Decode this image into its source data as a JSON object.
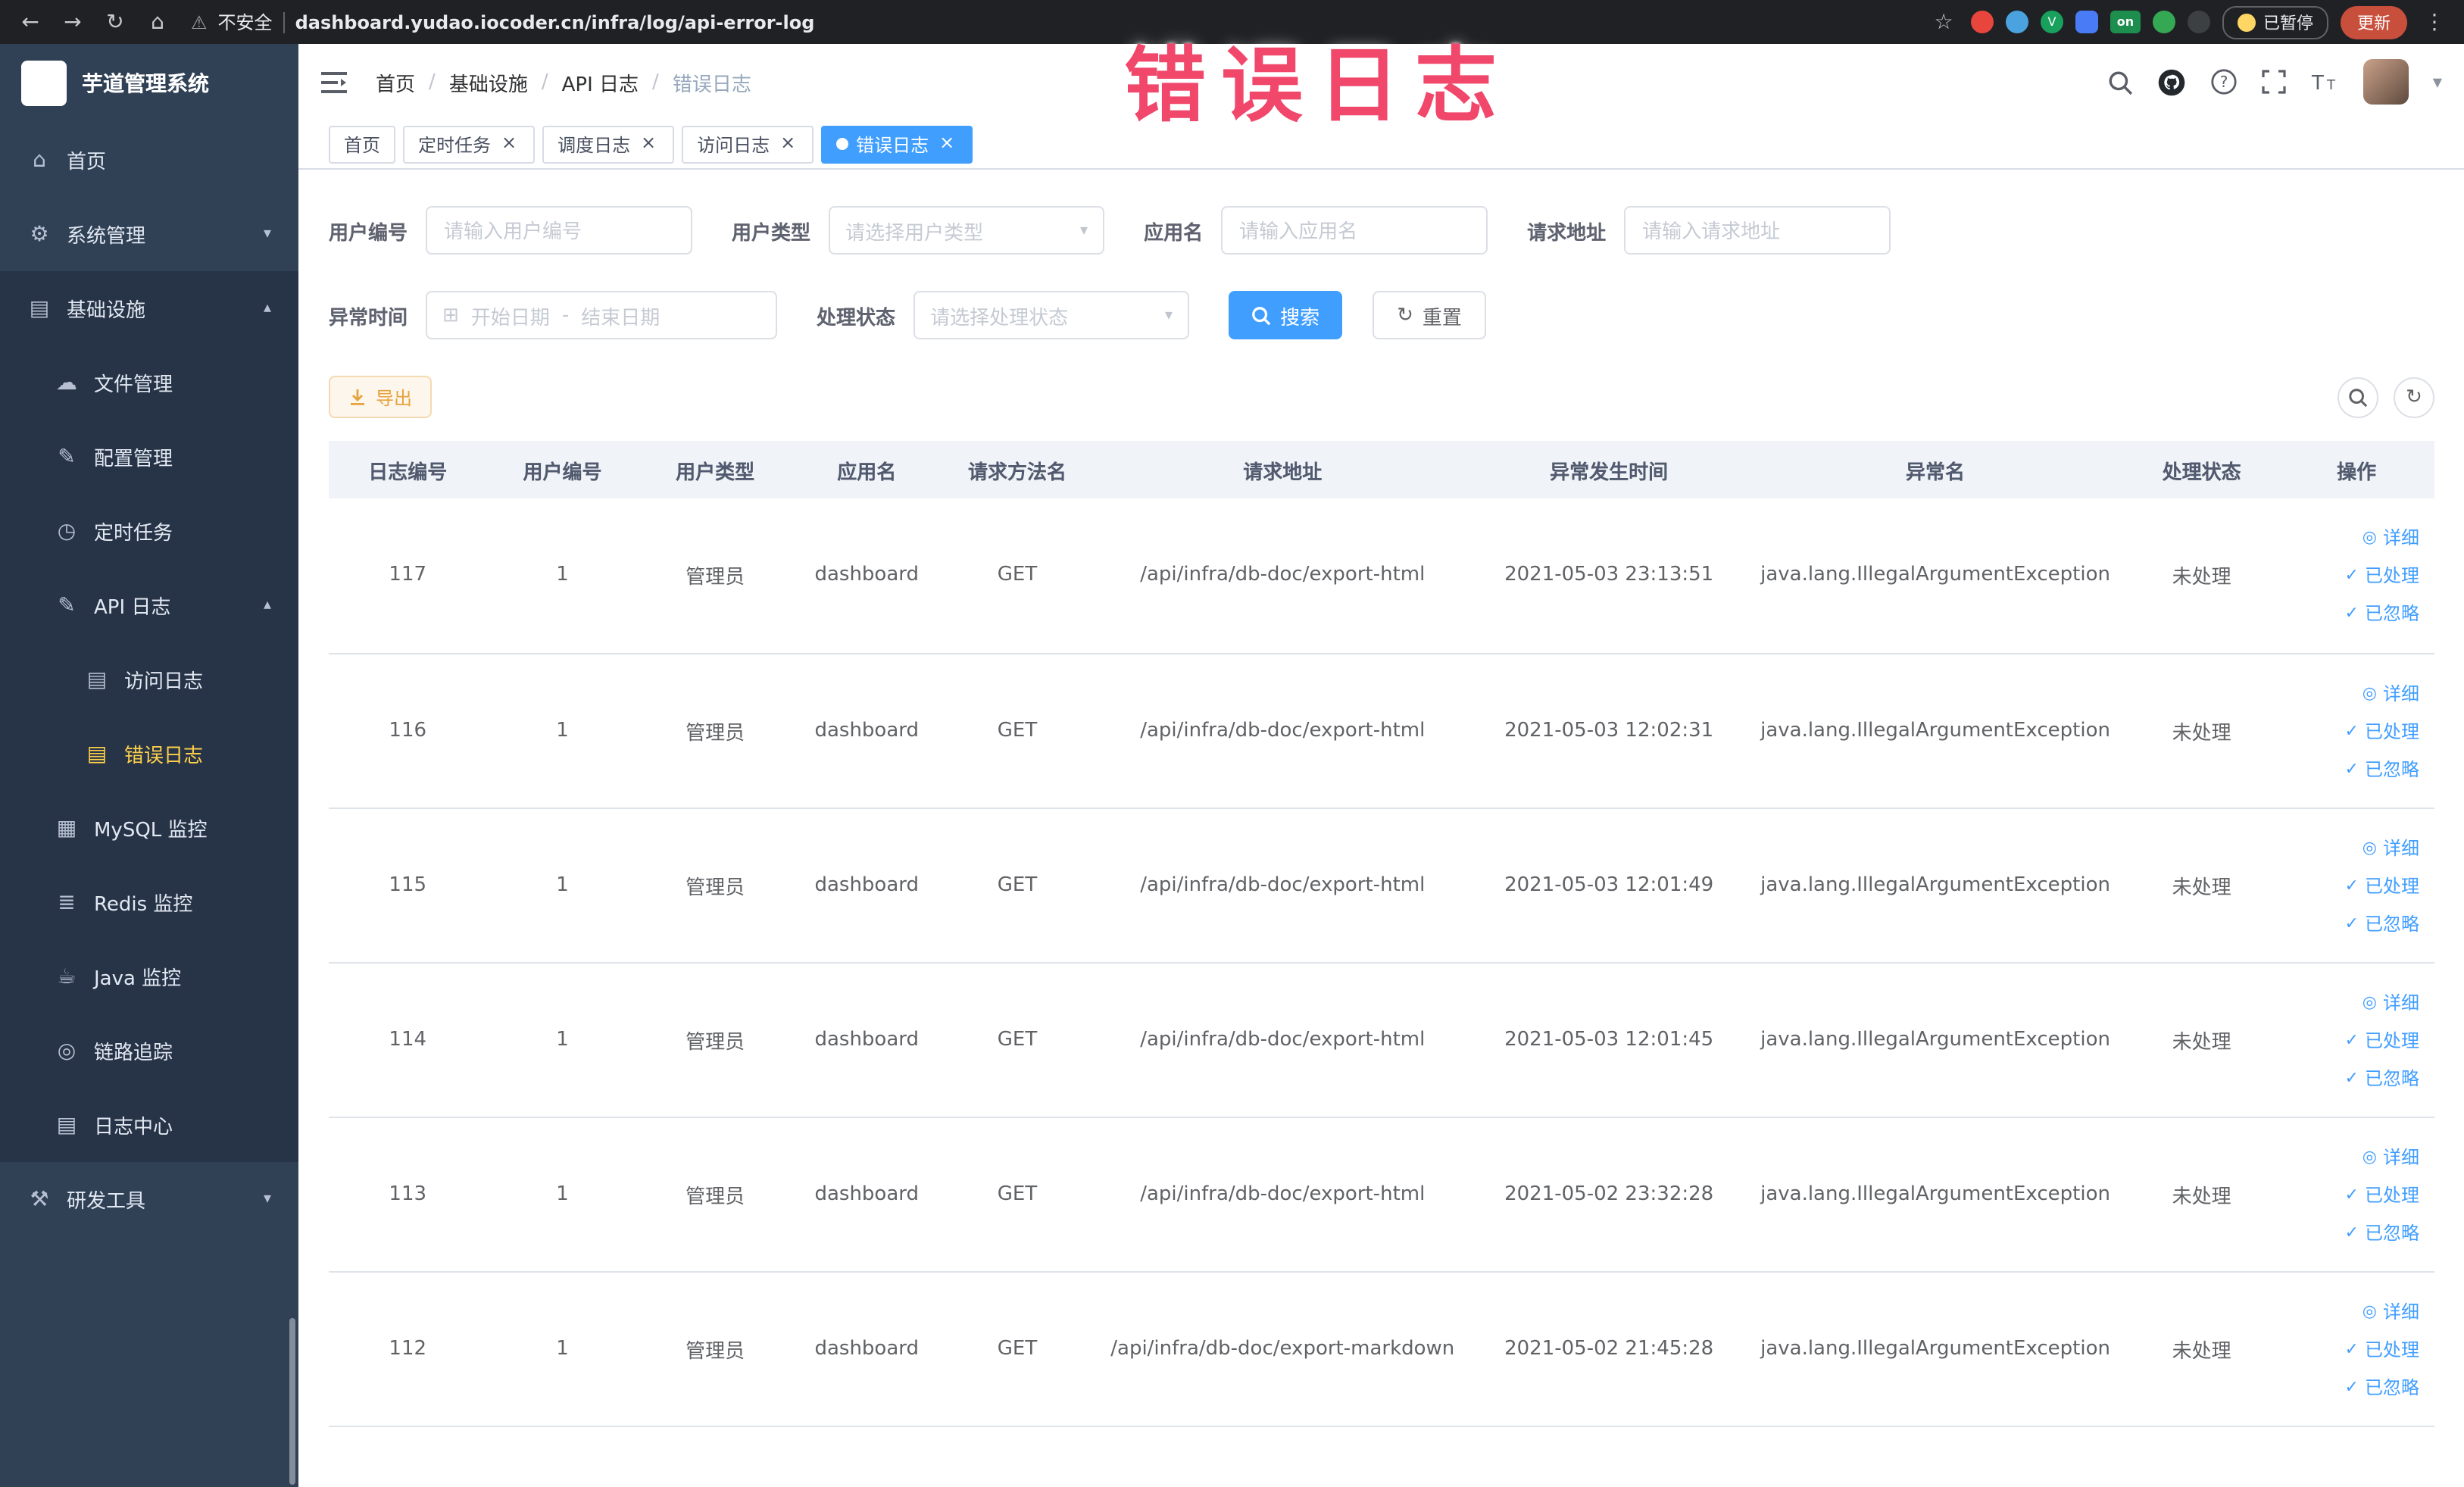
{
  "annotation": {
    "text": "错误日志"
  },
  "colors": {
    "primary": "#409eff",
    "warning_text": "#e6a23c",
    "sidebar_bg": "#304156",
    "sidebar_submenu_bg": "#273447",
    "active_menu_text": "#ffd04b",
    "annotation_pink": "#f0476b",
    "link_blue": "#409eff"
  },
  "browser": {
    "security_label": "不安全",
    "url": "dashboard.yudao.iocoder.cn/infra/log/api-error-log",
    "ext_v_label": "V",
    "on_badge": "on",
    "paused_badge": "已暂停",
    "update_button": "更新"
  },
  "icons": {
    "back": "←",
    "forward": "→",
    "reload": "↻",
    "home": "⌂",
    "warning": "⚠",
    "star": "☆",
    "menu_dots": "⋮",
    "close": "×",
    "chevron_down": "▾",
    "chevron_up": "▴",
    "dropdown": "▾",
    "calendar": "⊞",
    "check": "✓",
    "eye": "◎",
    "refresh": "↻",
    "caret": "▼",
    "separator": "/",
    "range_dash": "-"
  },
  "sidebar": {
    "logo_title": "芋道管理系统",
    "items": [
      {
        "label": "首页",
        "icon": "⌂"
      },
      {
        "label": "系统管理",
        "icon": "⚙"
      },
      {
        "label": "基础设施",
        "icon": "▤"
      },
      {
        "label": "文件管理",
        "icon": "☁"
      },
      {
        "label": "配置管理",
        "icon": "✎"
      },
      {
        "label": "定时任务",
        "icon": "◷"
      },
      {
        "label": "API 日志",
        "icon": "✎"
      },
      {
        "label": "访问日志",
        "icon": "▤"
      },
      {
        "label": "错误日志",
        "icon": "▤"
      },
      {
        "label": "MySQL 监控",
        "icon": "▦"
      },
      {
        "label": "Redis 监控",
        "icon": "≣"
      },
      {
        "label": "Java 监控",
        "icon": "☕"
      },
      {
        "label": "链路追踪",
        "icon": "◎"
      },
      {
        "label": "日志中心",
        "icon": "▤"
      },
      {
        "label": "研发工具",
        "icon": "⚒"
      }
    ]
  },
  "breadcrumb": [
    "首页",
    "基础设施",
    "API 日志",
    "错误日志"
  ],
  "tabs": [
    {
      "label": "首页"
    },
    {
      "label": "定时任务"
    },
    {
      "label": "调度日志"
    },
    {
      "label": "访问日志"
    },
    {
      "label": "错误日志"
    }
  ],
  "filters": {
    "user_id_label": "用户编号",
    "user_id_placeholder": "请输入用户编号",
    "user_type_label": "用户类型",
    "user_type_placeholder": "请选择用户类型",
    "app_name_label": "应用名",
    "app_name_placeholder": "请输入应用名",
    "request_url_label": "请求地址",
    "request_url_placeholder": "请输入请求地址",
    "exception_time_label": "异常时间",
    "start_date_placeholder": "开始日期",
    "end_date_placeholder": "结束日期",
    "process_status_label": "处理状态",
    "process_status_placeholder": "请选择处理状态",
    "search_button": "搜索",
    "reset_button": "重置"
  },
  "toolbar": {
    "export_button": "导出"
  },
  "table": {
    "columns": [
      "日志编号",
      "用户编号",
      "用户类型",
      "应用名",
      "请求方法名",
      "请求地址",
      "异常发生时间",
      "异常名",
      "处理状态",
      "操作"
    ],
    "actions": [
      "详细",
      "已处理",
      "已忽略"
    ],
    "rows": [
      {
        "id": "117",
        "user_id": "1",
        "user_type": "管理员",
        "app": "dashboard",
        "method": "GET",
        "url": "/api/infra/db-doc/export-html",
        "time": "2021-05-03 23:13:51",
        "exception": "java.lang.IllegalArgumentException",
        "status": "未处理"
      },
      {
        "id": "116",
        "user_id": "1",
        "user_type": "管理员",
        "app": "dashboard",
        "method": "GET",
        "url": "/api/infra/db-doc/export-html",
        "time": "2021-05-03 12:02:31",
        "exception": "java.lang.IllegalArgumentException",
        "status": "未处理"
      },
      {
        "id": "115",
        "user_id": "1",
        "user_type": "管理员",
        "app": "dashboard",
        "method": "GET",
        "url": "/api/infra/db-doc/export-html",
        "time": "2021-05-03 12:01:49",
        "exception": "java.lang.IllegalArgumentException",
        "status": "未处理"
      },
      {
        "id": "114",
        "user_id": "1",
        "user_type": "管理员",
        "app": "dashboard",
        "method": "GET",
        "url": "/api/infra/db-doc/export-html",
        "time": "2021-05-03 12:01:45",
        "exception": "java.lang.IllegalArgumentException",
        "status": "未处理"
      },
      {
        "id": "113",
        "user_id": "1",
        "user_type": "管理员",
        "app": "dashboard",
        "method": "GET",
        "url": "/api/infra/db-doc/export-html",
        "time": "2021-05-02 23:32:28",
        "exception": "java.lang.IllegalArgumentException",
        "status": "未处理"
      },
      {
        "id": "112",
        "user_id": "1",
        "user_type": "管理员",
        "app": "dashboard",
        "method": "GET",
        "url": "/api/infra/db-doc/export-markdown",
        "time": "2021-05-02 21:45:28",
        "exception": "java.lang.IllegalArgumentException",
        "status": "未处理"
      }
    ]
  }
}
